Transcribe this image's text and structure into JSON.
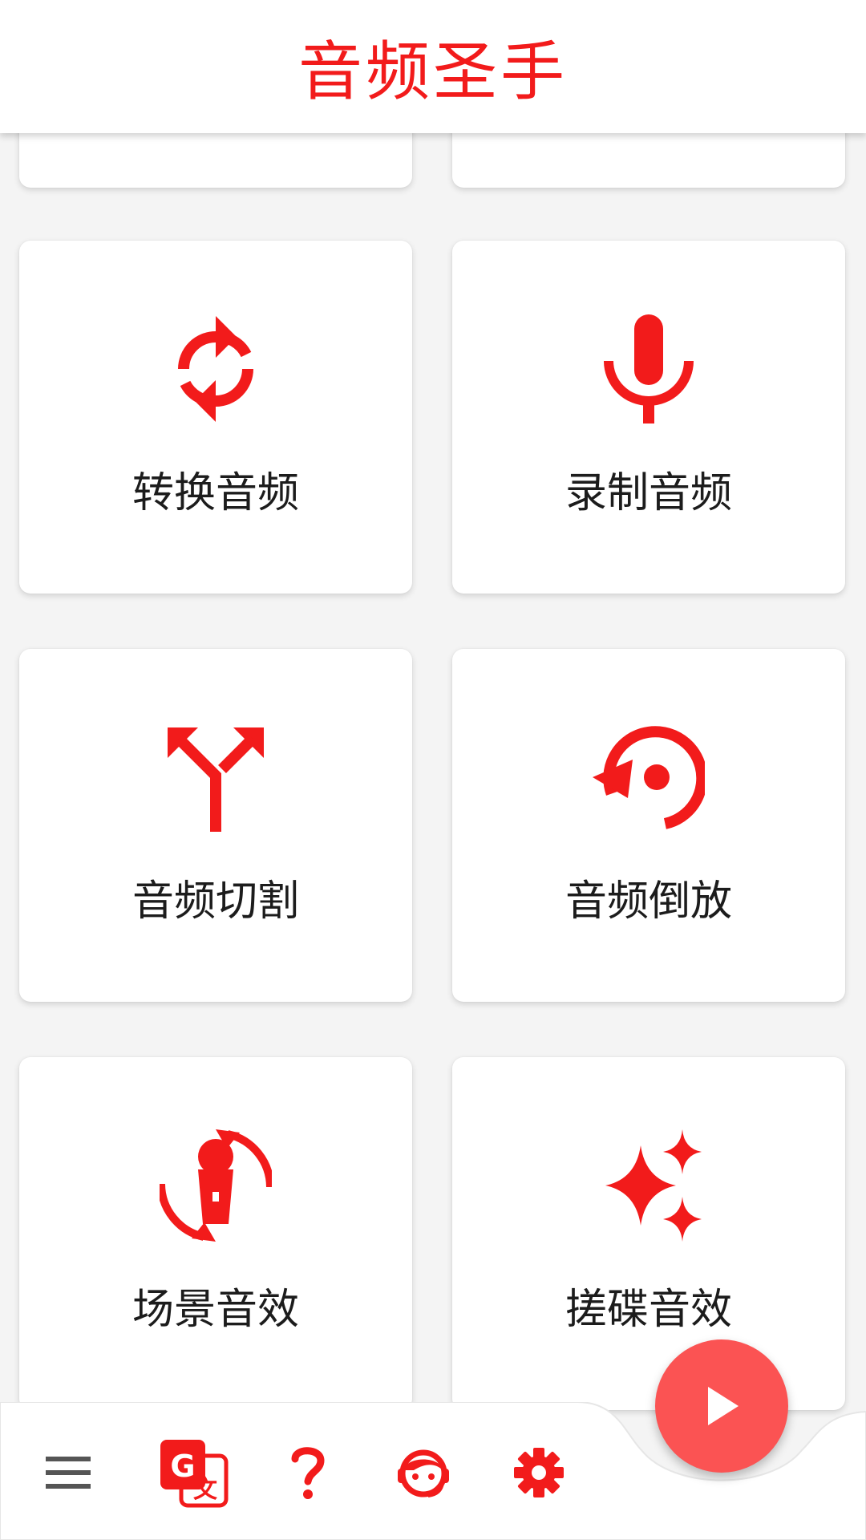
{
  "app": {
    "title": "音频圣手"
  },
  "colors": {
    "accent": "#f21b1b",
    "fab": "#fb5353",
    "card_bg": "#ffffff",
    "page_bg": "#f4f4f4",
    "text": "#1c1c1c",
    "menu_icon": "#555555"
  },
  "cards": [
    {
      "label": "转换音频",
      "icon": "sync-arrows-icon"
    },
    {
      "label": "录制音频",
      "icon": "microphone-icon"
    },
    {
      "label": "音频切割",
      "icon": "split-arrows-icon"
    },
    {
      "label": "音频倒放",
      "icon": "reverse-replay-icon"
    },
    {
      "label": "场景音效",
      "icon": "handheld-mic-rotate-icon"
    },
    {
      "label": "搓碟音效",
      "icon": "sparkles-icon"
    }
  ],
  "bottom_nav": {
    "items": [
      {
        "icon": "menu-icon"
      },
      {
        "icon": "translate-icon"
      },
      {
        "icon": "help-icon"
      },
      {
        "icon": "support-agent-icon"
      },
      {
        "icon": "settings-gear-icon"
      }
    ],
    "fab_icon": "play-icon"
  }
}
